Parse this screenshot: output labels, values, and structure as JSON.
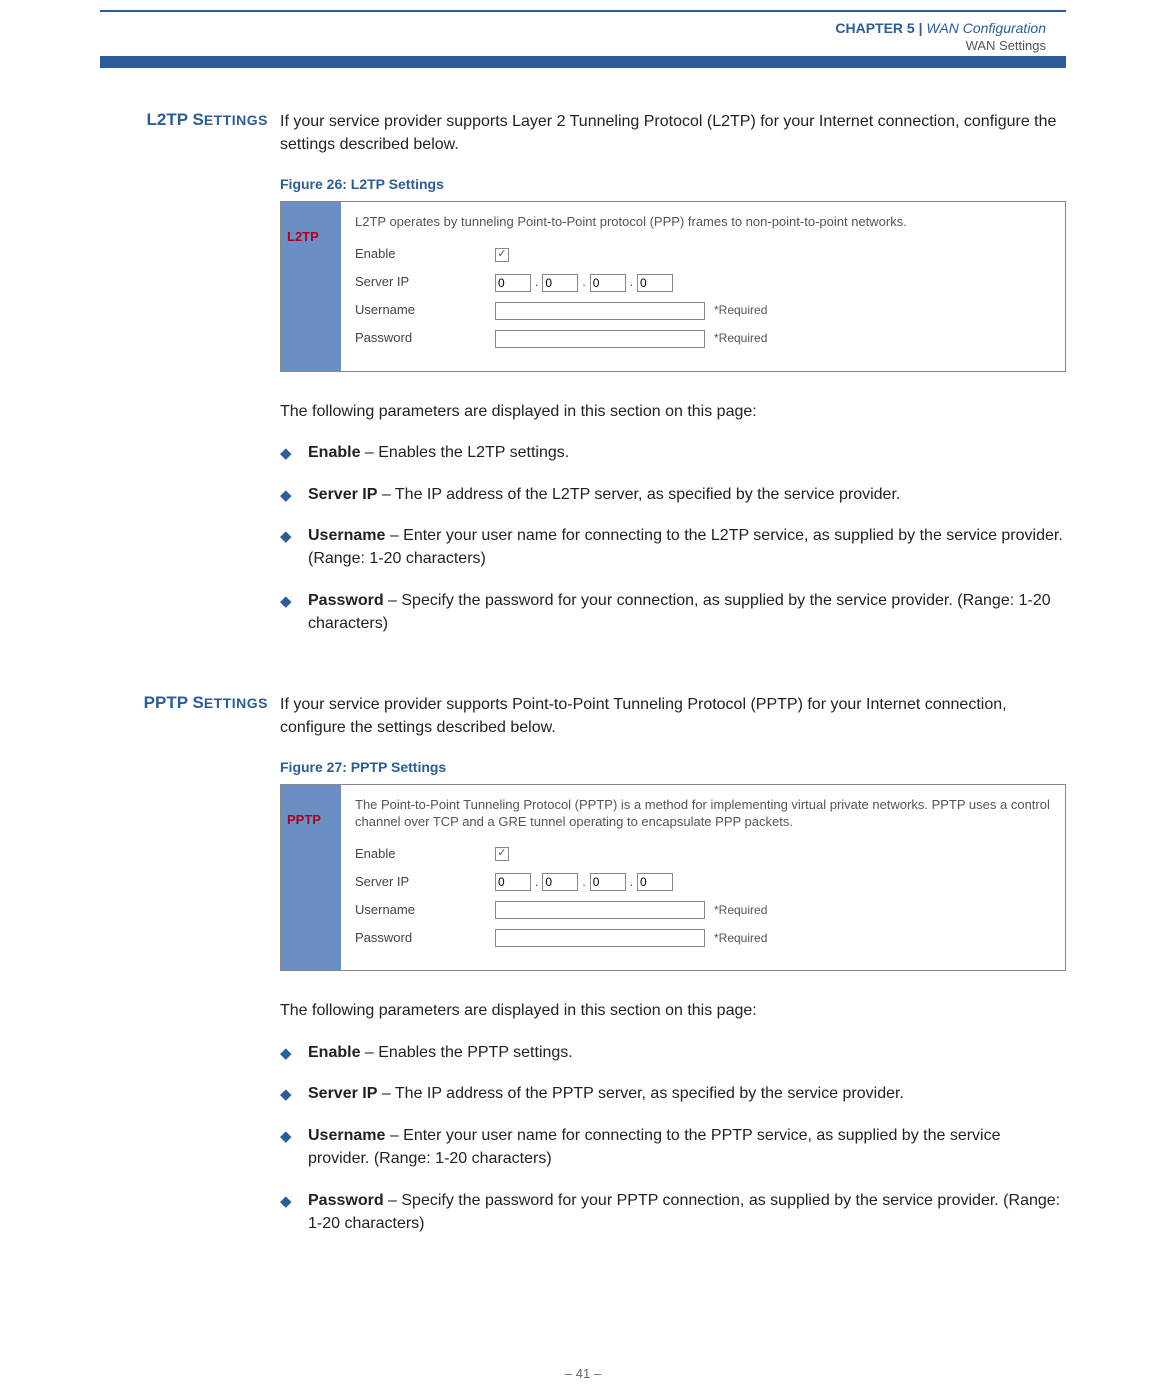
{
  "header": {
    "chapter_label": "CHAPTER 5",
    "chapter_sep": "  |  ",
    "chapter_title": "WAN Configuration",
    "subtitle": "WAN Settings"
  },
  "l2tp": {
    "heading_first": "L2TP S",
    "heading_rest": "ETTINGS",
    "intro": "If your service provider supports Layer 2 Tunneling Protocol (L2TP) for your Internet connection, configure the settings described below.",
    "figure_caption": "Figure 26:  L2TP Settings",
    "shot": {
      "sidebar": "L2TP",
      "desc": "L2TP operates by tunneling Point-to-Point protocol (PPP) frames to non-point-to-point networks.",
      "labels": {
        "enable": "Enable",
        "server_ip": "Server IP",
        "username": "Username",
        "password": "Password"
      },
      "ip": [
        "0",
        "0",
        "0",
        "0"
      ],
      "checked": "✓",
      "required": "*Required"
    },
    "param_intro": "The following parameters are displayed in this section on this page:",
    "bullets": [
      {
        "term": "Enable",
        "desc": " – Enables the L2TP settings."
      },
      {
        "term": "Server IP",
        "desc": " – The IP address of the L2TP server, as specified by the service provider."
      },
      {
        "term": "Username",
        "desc": " – Enter your user name for connecting to the L2TP service, as supplied by the service provider. (Range: 1-20 characters)"
      },
      {
        "term": "Password",
        "desc": " – Specify the password for your connection, as supplied by the service provider. (Range: 1-20 characters)"
      }
    ]
  },
  "pptp": {
    "heading_first": "PPTP S",
    "heading_rest": "ETTINGS",
    "intro": "If your service provider supports Point-to-Point Tunneling Protocol (PPTP) for your Internet connection, configure the settings described below.",
    "figure_caption": "Figure 27:  PPTP Settings",
    "shot": {
      "sidebar": "PPTP",
      "desc": "The Point-to-Point Tunneling Protocol (PPTP) is a method for implementing virtual private networks. PPTP uses a control channel over TCP and a GRE tunnel operating to encapsulate PPP packets.",
      "labels": {
        "enable": "Enable",
        "server_ip": "Server IP",
        "username": "Username",
        "password": "Password"
      },
      "ip": [
        "0",
        "0",
        "0",
        "0"
      ],
      "checked": "✓",
      "required": "*Required"
    },
    "param_intro": "The following parameters are displayed in this section on this page:",
    "bullets": [
      {
        "term": "Enable",
        "desc": " – Enables the PPTP settings."
      },
      {
        "term": "Server IP",
        "desc": " – The IP address of the PPTP server, as specified by the service provider."
      },
      {
        "term": "Username",
        "desc": " – Enter your user name for connecting to the PPTP service, as supplied by the service provider. (Range: 1-20 characters)"
      },
      {
        "term": "Password",
        "desc": " – Specify the password for your PPTP connection, as supplied by the service provider. (Range: 1-20 characters)"
      }
    ]
  },
  "footer": {
    "page_number": "–  41  –"
  }
}
